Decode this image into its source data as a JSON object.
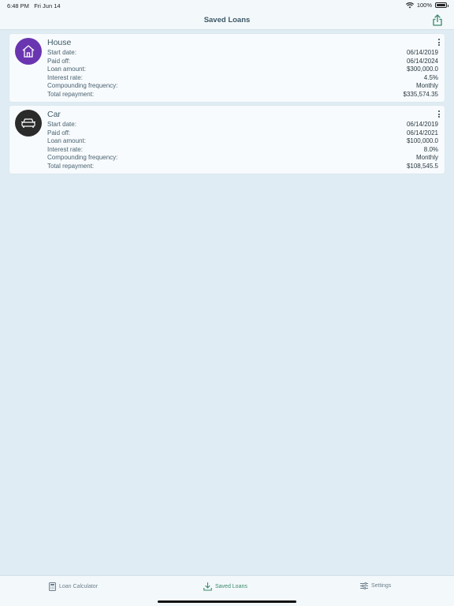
{
  "status": {
    "time": "6:48 PM",
    "date": "Fri Jun 14",
    "battery": "100%"
  },
  "nav": {
    "title": "Saved Loans"
  },
  "colors": {
    "accent": "#3b8a6a",
    "house": "#6a35b0",
    "car": "#2b2b2b"
  },
  "loans": [
    {
      "name": "House",
      "icon": "house-icon",
      "rows": [
        {
          "label": "Start date:",
          "value": "06/14/2019"
        },
        {
          "label": "Paid off:",
          "value": "06/14/2024"
        },
        {
          "label": "Loan amount:",
          "value": "$300,000.0"
        },
        {
          "label": "Interest rate:",
          "value": "4.5%"
        },
        {
          "label": "Compounding frequency:",
          "value": "Monthly"
        },
        {
          "label": "Total repayment:",
          "value": "$335,574.35"
        }
      ]
    },
    {
      "name": "Car",
      "icon": "car-icon",
      "rows": [
        {
          "label": "Start date:",
          "value": "06/14/2019"
        },
        {
          "label": "Paid off:",
          "value": "06/14/2021"
        },
        {
          "label": "Loan amount:",
          "value": "$100,000.0"
        },
        {
          "label": "Interest rate:",
          "value": "8.0%"
        },
        {
          "label": "Compounding frequency:",
          "value": "Monthly"
        },
        {
          "label": "Total repayment:",
          "value": "$108,545.5"
        }
      ]
    }
  ],
  "tabs": [
    {
      "label": "Loan Calculator",
      "icon": "calculator-icon"
    },
    {
      "label": "Saved Loans",
      "icon": "download-icon"
    },
    {
      "label": "Settings",
      "icon": "sliders-icon"
    }
  ]
}
